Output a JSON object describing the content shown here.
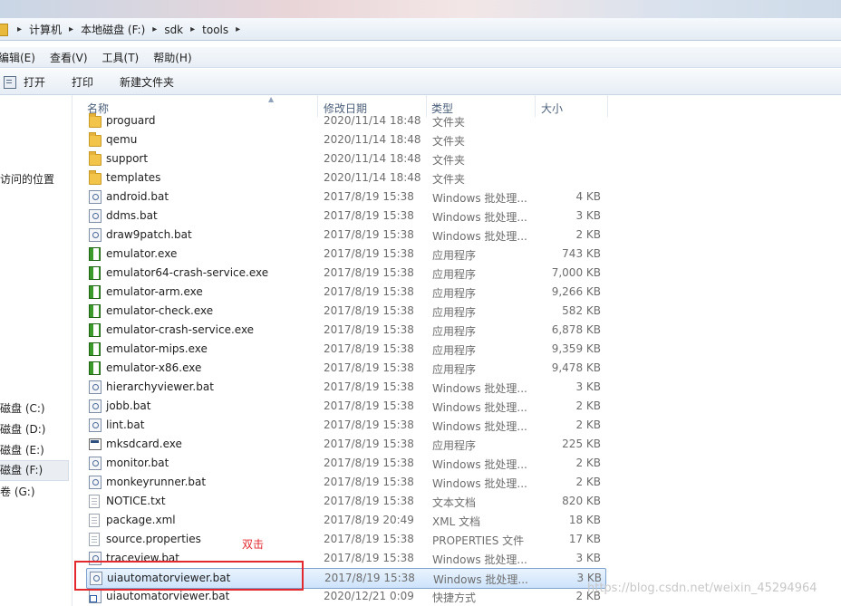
{
  "address_bar": {
    "crumbs": [
      "计算机",
      "本地磁盘 (F:)",
      "sdk",
      "tools"
    ]
  },
  "menu": {
    "items": [
      "编辑(E)",
      "查看(V)",
      "工具(T)",
      "帮助(H)"
    ]
  },
  "toolbar": {
    "open_label": "打开",
    "print_label": "打印",
    "new_folder_label": "新建文件夹"
  },
  "nav": {
    "recent_label": "访问的位置",
    "drives": [
      {
        "label": "磁盘 (C:)"
      },
      {
        "label": "磁盘 (D:)"
      },
      {
        "label": "磁盘 (E:)"
      },
      {
        "label": "磁盘 (F:)",
        "selected": true
      },
      {
        "label": "卷 (G:)"
      }
    ]
  },
  "columns": {
    "name": "名称",
    "date": "修改日期",
    "type": "类型",
    "size": "大小"
  },
  "files": [
    {
      "name": "proguard",
      "date": "2020/11/14 18:48",
      "type": "文件夹",
      "size": "",
      "icon": "folder-icon"
    },
    {
      "name": "qemu",
      "date": "2020/11/14 18:48",
      "type": "文件夹",
      "size": "",
      "icon": "folder-icon"
    },
    {
      "name": "support",
      "date": "2020/11/14 18:48",
      "type": "文件夹",
      "size": "",
      "icon": "folder-icon"
    },
    {
      "name": "templates",
      "date": "2020/11/14 18:48",
      "type": "文件夹",
      "size": "",
      "icon": "folder-icon"
    },
    {
      "name": "android.bat",
      "date": "2017/8/19 15:38",
      "type": "Windows 批处理...",
      "size": "4 KB",
      "icon": "batch-file-icon"
    },
    {
      "name": "ddms.bat",
      "date": "2017/8/19 15:38",
      "type": "Windows 批处理...",
      "size": "3 KB",
      "icon": "batch-file-icon"
    },
    {
      "name": "draw9patch.bat",
      "date": "2017/8/19 15:38",
      "type": "Windows 批处理...",
      "size": "2 KB",
      "icon": "batch-file-icon"
    },
    {
      "name": "emulator.exe",
      "date": "2017/8/19 15:38",
      "type": "应用程序",
      "size": "743 KB",
      "icon": "android-app-icon"
    },
    {
      "name": "emulator64-crash-service.exe",
      "date": "2017/8/19 15:38",
      "type": "应用程序",
      "size": "7,000 KB",
      "icon": "android-app-icon"
    },
    {
      "name": "emulator-arm.exe",
      "date": "2017/8/19 15:38",
      "type": "应用程序",
      "size": "9,266 KB",
      "icon": "android-app-icon"
    },
    {
      "name": "emulator-check.exe",
      "date": "2017/8/19 15:38",
      "type": "应用程序",
      "size": "582 KB",
      "icon": "android-app-icon"
    },
    {
      "name": "emulator-crash-service.exe",
      "date": "2017/8/19 15:38",
      "type": "应用程序",
      "size": "6,878 KB",
      "icon": "android-app-icon"
    },
    {
      "name": "emulator-mips.exe",
      "date": "2017/8/19 15:38",
      "type": "应用程序",
      "size": "9,359 KB",
      "icon": "android-app-icon"
    },
    {
      "name": "emulator-x86.exe",
      "date": "2017/8/19 15:38",
      "type": "应用程序",
      "size": "9,478 KB",
      "icon": "android-app-icon"
    },
    {
      "name": "hierarchyviewer.bat",
      "date": "2017/8/19 15:38",
      "type": "Windows 批处理...",
      "size": "3 KB",
      "icon": "batch-file-icon"
    },
    {
      "name": "jobb.bat",
      "date": "2017/8/19 15:38",
      "type": "Windows 批处理...",
      "size": "2 KB",
      "icon": "batch-file-icon"
    },
    {
      "name": "lint.bat",
      "date": "2017/8/19 15:38",
      "type": "Windows 批处理...",
      "size": "2 KB",
      "icon": "batch-file-icon"
    },
    {
      "name": "mksdcard.exe",
      "date": "2017/8/19 15:38",
      "type": "应用程序",
      "size": "225 KB",
      "icon": "console-app-icon"
    },
    {
      "name": "monitor.bat",
      "date": "2017/8/19 15:38",
      "type": "Windows 批处理...",
      "size": "2 KB",
      "icon": "batch-file-icon"
    },
    {
      "name": "monkeyrunner.bat",
      "date": "2017/8/19 15:38",
      "type": "Windows 批处理...",
      "size": "2 KB",
      "icon": "batch-file-icon"
    },
    {
      "name": "NOTICE.txt",
      "date": "2017/8/19 15:38",
      "type": "文本文档",
      "size": "820 KB",
      "icon": "text-file-icon"
    },
    {
      "name": "package.xml",
      "date": "2017/8/19 20:49",
      "type": "XML 文档",
      "size": "18 KB",
      "icon": "xml-file-icon"
    },
    {
      "name": "source.properties",
      "date": "2017/8/19 15:38",
      "type": "PROPERTIES 文件",
      "size": "17 KB",
      "icon": "text-file-icon"
    },
    {
      "name": "traceview.bat",
      "date": "2017/8/19 15:38",
      "type": "Windows 批处理...",
      "size": "3 KB",
      "icon": "batch-file-icon"
    },
    {
      "name": "uiautomatorviewer.bat",
      "date": "2017/8/19 15:38",
      "type": "Windows 批处理...",
      "size": "3 KB",
      "icon": "batch-file-icon",
      "selected": true
    },
    {
      "name": "uiautomatorviewer.bat",
      "date": "2020/12/21 0:09",
      "type": "快捷方式",
      "size": "2 KB",
      "icon": "shortcut-icon"
    }
  ],
  "annotation": {
    "label": "双击",
    "color": "#e3282e"
  },
  "watermark": "https://blog.csdn.net/weixin_45294964"
}
